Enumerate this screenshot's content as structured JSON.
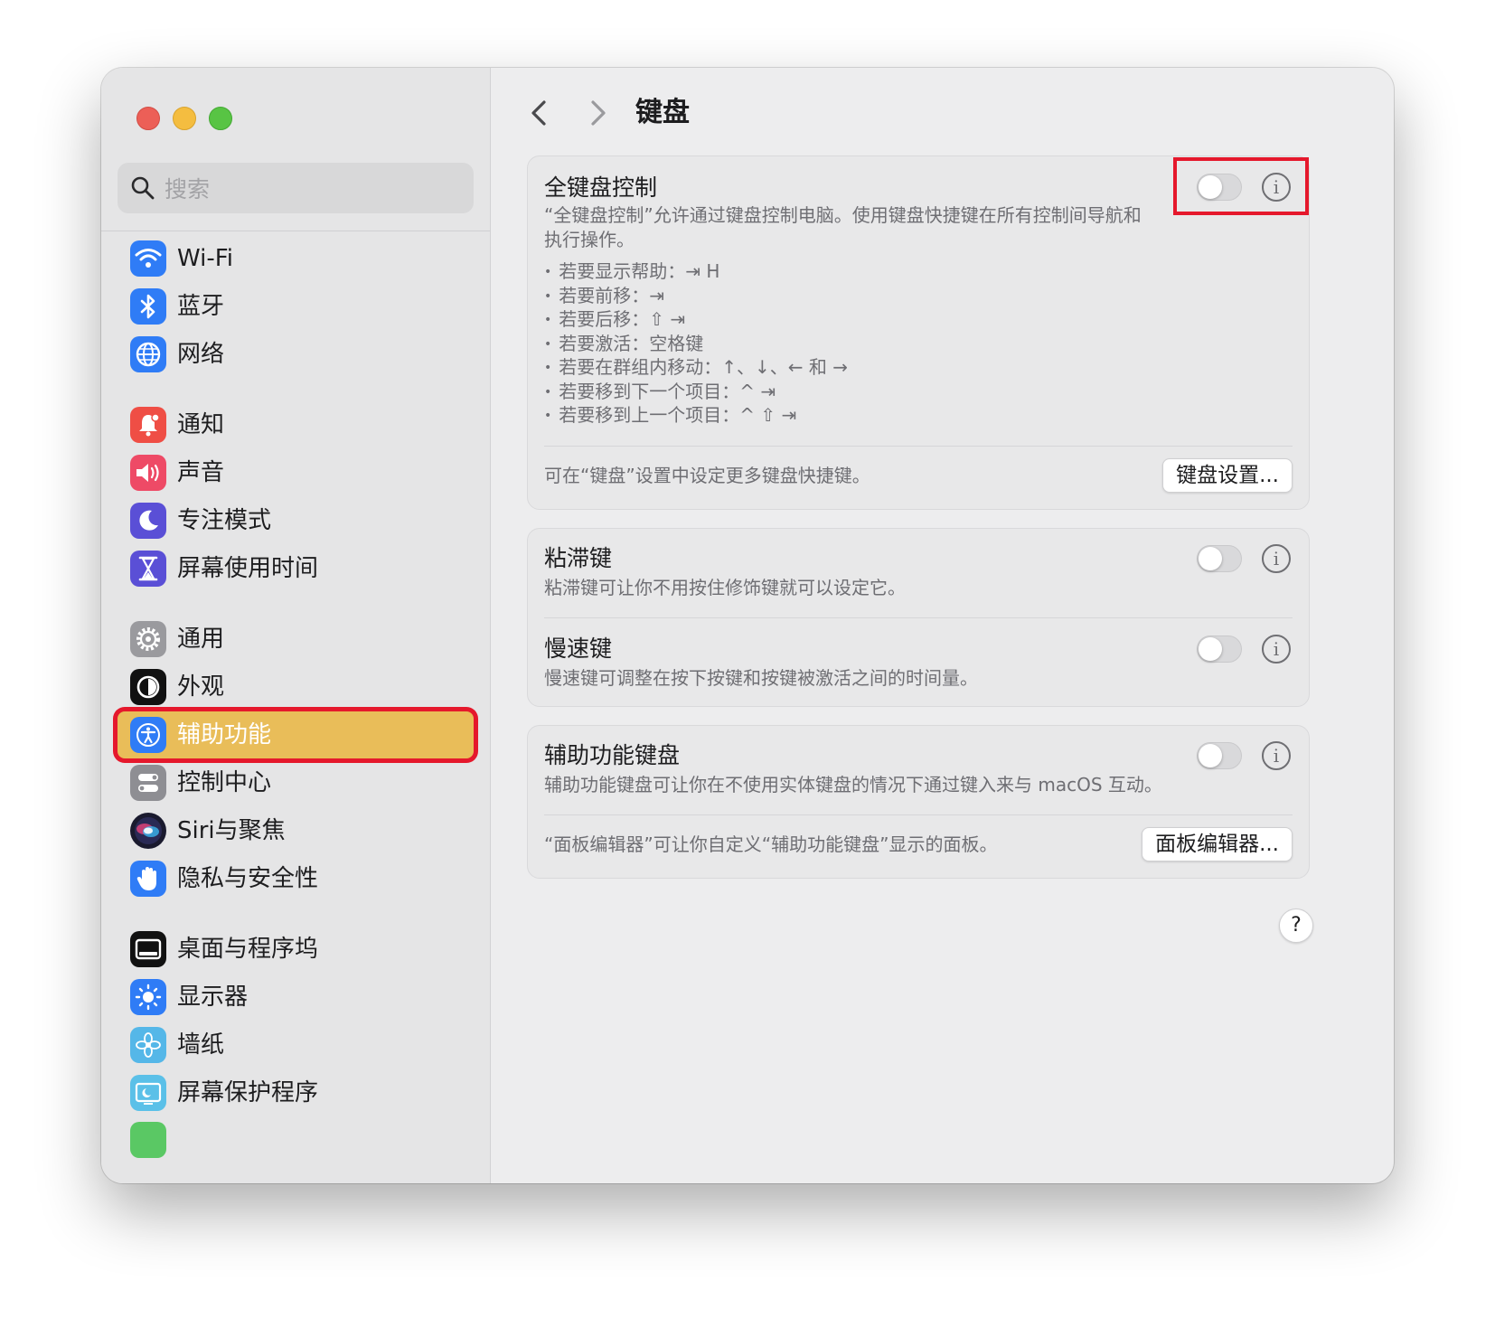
{
  "window": {
    "title": "键盘"
  },
  "sidebar": {
    "search_placeholder": "搜索",
    "items": [
      {
        "label": "Wi-Fi",
        "icon": "wifi-icon",
        "color": "#2f7cf6"
      },
      {
        "label": "蓝牙",
        "icon": "bluetooth-icon",
        "color": "#2f7cf6"
      },
      {
        "label": "网络",
        "icon": "globe-icon",
        "color": "#2f7cf6"
      },
      {
        "label": "通知",
        "icon": "bell-icon",
        "color": "#ef4e45"
      },
      {
        "label": "声音",
        "icon": "speaker-icon",
        "color": "#ee4a66"
      },
      {
        "label": "专注模式",
        "icon": "moon-icon",
        "color": "#5a4fd6"
      },
      {
        "label": "屏幕使用时间",
        "icon": "hourglass-icon",
        "color": "#5a4fd6"
      },
      {
        "label": "通用",
        "icon": "gear-icon",
        "color": "#9a9a9e"
      },
      {
        "label": "外观",
        "icon": "appearance-icon",
        "color": "#111111"
      },
      {
        "label": "辅助功能",
        "icon": "accessibility-icon",
        "color": "#2f7cf6",
        "selected": true
      },
      {
        "label": "控制中心",
        "icon": "control-center-icon",
        "color": "#8e8e93"
      },
      {
        "label": "Siri与聚焦",
        "icon": "siri-icon",
        "color": "#3b3b5f"
      },
      {
        "label": "隐私与安全性",
        "icon": "hand-icon",
        "color": "#2f7cf6"
      },
      {
        "label": "桌面与程序坞",
        "icon": "dock-icon",
        "color": "#111111"
      },
      {
        "label": "显示器",
        "icon": "sun-icon",
        "color": "#2f7cf6"
      },
      {
        "label": "墙纸",
        "icon": "flower-icon",
        "color": "#55b7e8"
      },
      {
        "label": "屏幕保护程序",
        "icon": "screensaver-icon",
        "color": "#5bc0e8"
      }
    ]
  },
  "main": {
    "full_keyboard": {
      "title": "全键盘控制",
      "desc": "“全键盘控制”允许通过键盘控制电脑。使用键盘快捷键在所有控制间导航和执行操作。",
      "enabled": false,
      "hints": [
        "若要显示帮助：⇥ H",
        "若要前移：⇥",
        "若要后移：⇧ ⇥",
        "若要激活：空格键",
        "若要在群组内移动：↑、↓、← 和 →",
        "若要移到下一个项目：^ ⇥",
        "若要移到上一个项目：^ ⇧ ⇥"
      ],
      "footer": "可在“键盘”设置中设定更多键盘快捷键。",
      "button": "键盘设置..."
    },
    "sticky_keys": {
      "title": "粘滞键",
      "desc": "粘滞键可让你不用按住修饰键就可以设定它。",
      "enabled": false
    },
    "slow_keys": {
      "title": "慢速键",
      "desc": "慢速键可调整在按下按键和按键被激活之间的时间量。",
      "enabled": false
    },
    "accessibility_keyboard": {
      "title": "辅助功能键盘",
      "desc": "辅助功能键盘可让你在不使用实体键盘的情况下通过键入来与 macOS 互动。",
      "enabled": false,
      "footer": "“面板编辑器”可让你自定义“辅助功能键盘”显示的面板。",
      "button": "面板编辑器..."
    },
    "help_label": "?",
    "info_label": "i"
  },
  "highlight_color": "#e5182c"
}
